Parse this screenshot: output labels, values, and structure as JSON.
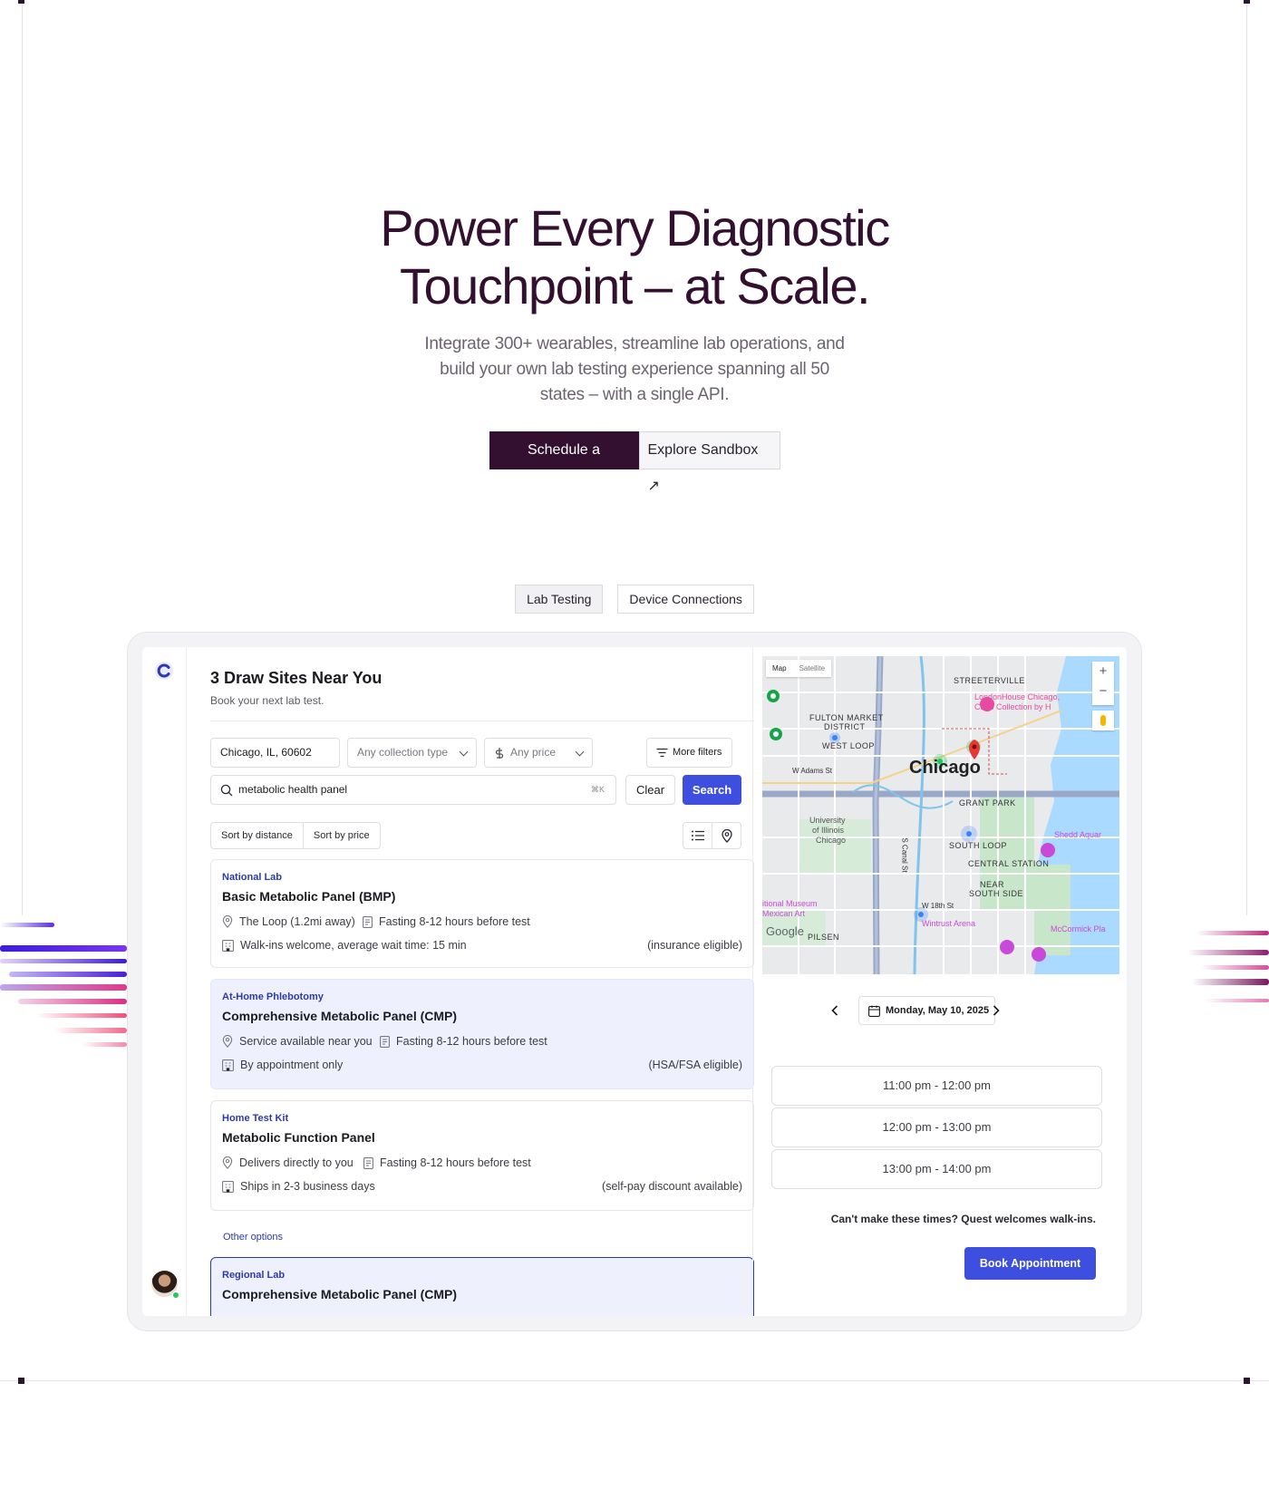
{
  "hero": {
    "title_line1": "Power Every Diagnostic",
    "title_line2": "Touchpoint – at Scale.",
    "description": "Integrate 300+ wearables, streamline lab operations, and build your own lab testing experience spanning all 50 states – with a single API.",
    "primary_cta": "Schedule a Demo",
    "secondary_cta": "Explore Sandbox ↗"
  },
  "tabs": [
    {
      "label": "Lab Testing",
      "active": true
    },
    {
      "label": "Device Connections",
      "active": false
    }
  ],
  "app": {
    "title": "3 Draw Sites Near You",
    "subtitle": "Book your next lab test.",
    "location_value": "Chicago, IL, 60602",
    "collection_type": "Any collection type",
    "price_filter": "Any price",
    "more_filters": "More filters",
    "search_value": "metabolic health panel",
    "search_shortcut": "⌘K",
    "clear_label": "Clear",
    "search_label": "Search",
    "sort_distance": "Sort by distance",
    "sort_price": "Sort by price",
    "results": [
      {
        "kind": "National Lab",
        "name": "Basic Metabolic Panel (BMP)",
        "location": "The Loop (1.2mi away)",
        "prep": "Fasting 8-12 hours before test",
        "availability": "Walk-ins welcome, average wait time: 15 min",
        "coverage": "(insurance eligible)"
      },
      {
        "kind": "At-Home Phlebotomy",
        "name": "Comprehensive Metabolic Panel (CMP)",
        "location": "Service available near you",
        "prep": "Fasting 8-12 hours before test",
        "availability": "By appointment only",
        "coverage": "(HSA/FSA eligible)"
      },
      {
        "kind": "Home Test Kit",
        "name": "Metabolic Function Panel",
        "location": "Delivers directly to you",
        "prep": "Fasting 8-12 hours before test",
        "availability": "Ships in 2-3 business days",
        "coverage": "(self-pay discount available)"
      }
    ],
    "other_options_label": "Other options",
    "other_result": {
      "kind": "Regional Lab",
      "name": "Comprehensive Metabolic Panel (CMP)"
    },
    "map": {
      "toggle_map": "Map",
      "toggle_satellite": "Satellite",
      "city": "Chicago",
      "labels": {
        "streeterville": "STREETERVILLE",
        "fulton": "FULTON MARKET",
        "district": "DISTRICT",
        "west_loop": "WEST LOOP",
        "adams": "W Adams St",
        "grant_park": "GRANT PARK",
        "uic1": "University",
        "uic2": "of Illinois",
        "uic3": "Chicago",
        "south_loop": "SOUTH LOOP",
        "central_station": "CENTRAL STATION",
        "near": "NEAR",
        "south_side": "SOUTH SIDE",
        "w18": "W 18th St",
        "wintrust": "Wintrust Arena",
        "mccormick": "McCormick Pla",
        "shedd": "Shedd Aquar",
        "london1": "LondonHouse Chicago,",
        "london2": "Curio Collection by H",
        "museum1": "itional Museum",
        "museum2": "Mexican Art",
        "pilsen": "PILSEN",
        "canal": "S Canal St",
        "google": "Google"
      }
    },
    "date": "Monday, May 10, 2025",
    "slots": [
      "11:00 pm  - 12:00 pm",
      "12:00 pm  - 13:00 pm",
      "13:00 pm  - 14:00 pm"
    ],
    "walkins_note": "Can't make these times? Quest welcomes walk-ins.",
    "book_label": "Book Appointment"
  },
  "colors": {
    "brand_dark": "#33102f",
    "accent_blue": "#3e4fe0",
    "link_blue": "#2e3aa8"
  }
}
